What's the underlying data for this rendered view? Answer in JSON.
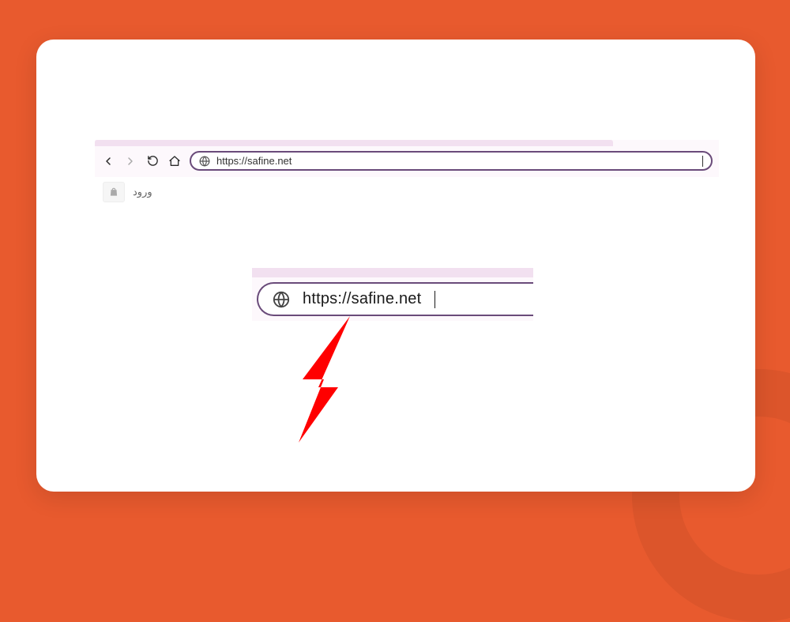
{
  "browser": {
    "address_bar": {
      "value": "https://safine.net"
    },
    "bookmarks": [
      {
        "label": "ورود"
      }
    ]
  },
  "zoom": {
    "url": "https://safine.net"
  }
}
